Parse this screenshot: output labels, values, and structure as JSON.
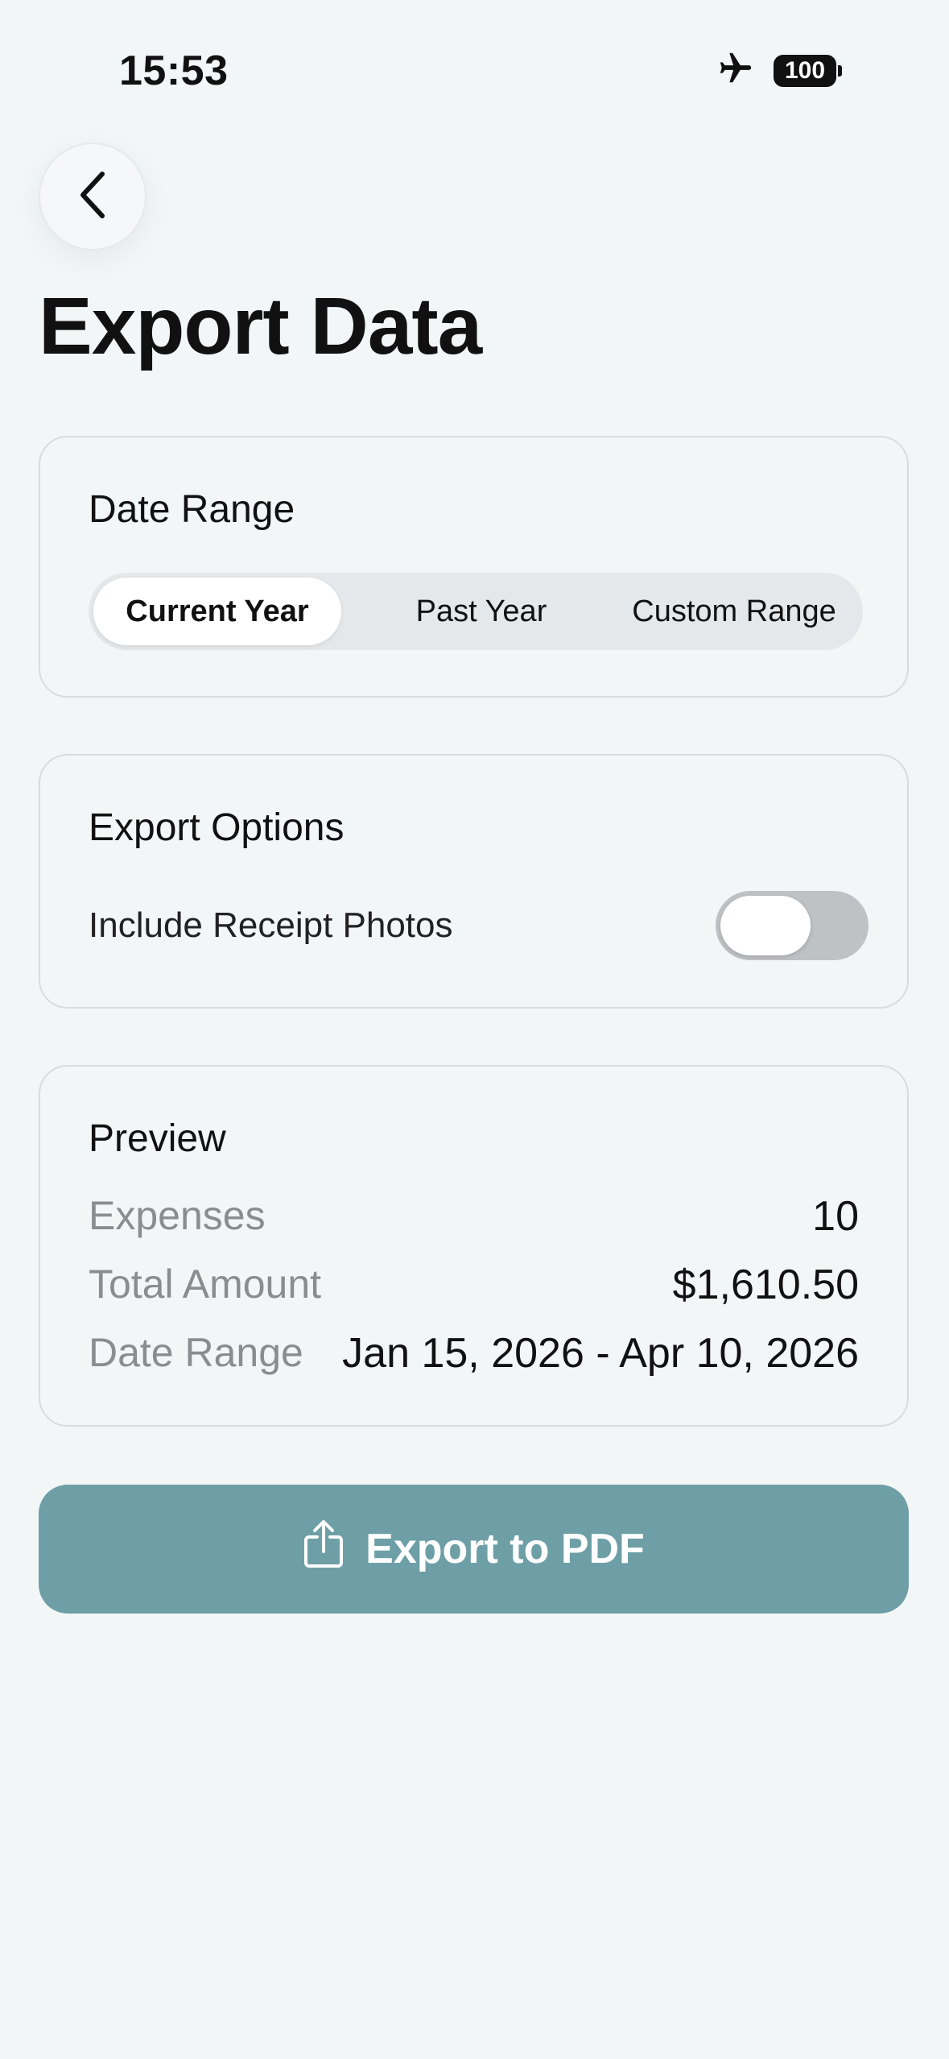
{
  "status_bar": {
    "time": "15:53",
    "battery": "100",
    "airplane_icon": "airplane-icon"
  },
  "nav": {
    "back_icon": "chevron-left-icon"
  },
  "title": "Export Data",
  "date_range": {
    "heading": "Date Range",
    "options": [
      "Current Year",
      "Past Year",
      "Custom Range"
    ],
    "selected": "Current Year"
  },
  "export_options": {
    "heading": "Export Options",
    "include_receipts_label": "Include Receipt Photos",
    "include_receipts_on": false
  },
  "preview": {
    "heading": "Preview",
    "rows": [
      {
        "label": "Expenses",
        "value": "10"
      },
      {
        "label": "Total Amount",
        "value": "$1,610.50"
      },
      {
        "label": "Date Range",
        "value": "Jan 15, 2026 - Apr 10, 2026"
      }
    ]
  },
  "export_button": {
    "label": "Export to PDF",
    "icon": "share-icon"
  },
  "colors": {
    "accent": "#6e9fa7",
    "background": "#f3f6f7",
    "toggle_off": "#bfc2c5"
  }
}
